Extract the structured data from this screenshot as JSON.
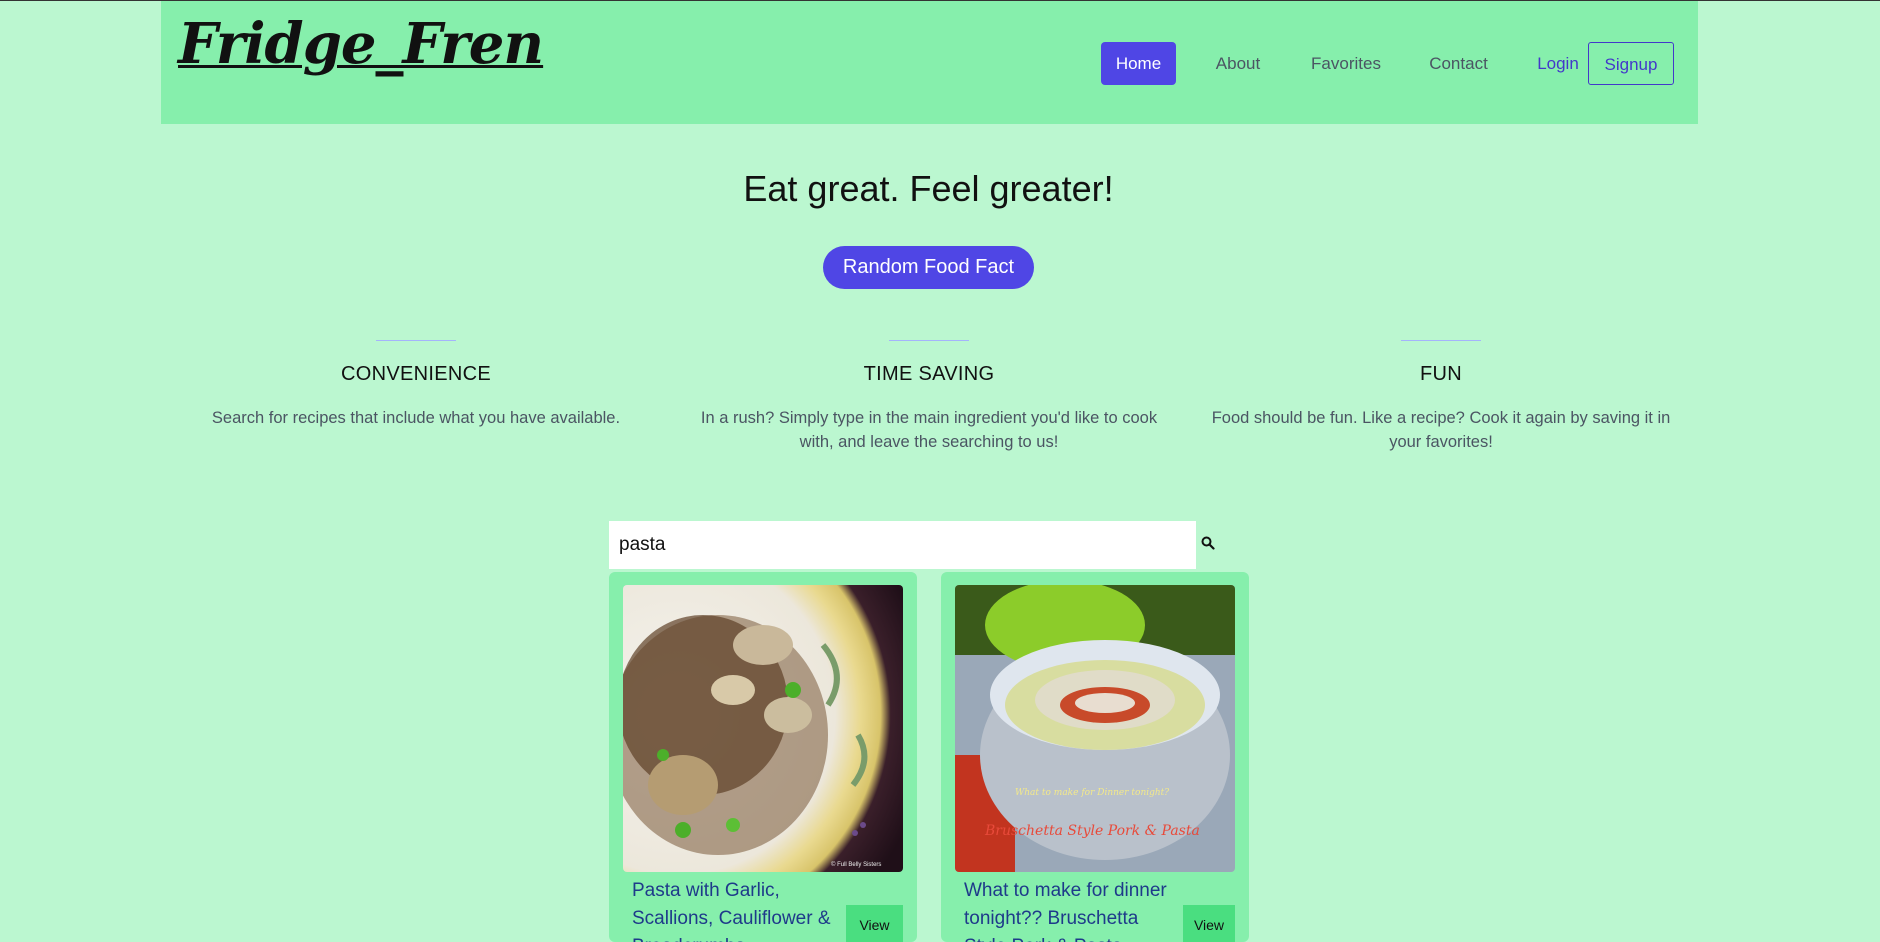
{
  "nav": {
    "logo": "Fridge_Fren",
    "home": "Home",
    "about": "About",
    "favorites": "Favorites",
    "contact": "Contact",
    "login": "Login",
    "signup": "Signup"
  },
  "hero": {
    "title": "Eat great. Feel greater!",
    "fact_button": "Random Food Fact"
  },
  "features": [
    {
      "title": "CONVENIENCE",
      "text": "Search for recipes that include what you have available."
    },
    {
      "title": "TIME SAVING",
      "text": "In a rush? Simply type in the main ingredient you'd like to cook with, and leave the searching to us!"
    },
    {
      "title": "FUN",
      "text": "Food should be fun. Like a recipe? Cook it again by saving it in your favorites!"
    }
  ],
  "search": {
    "value": "pasta",
    "icon": "search-icon"
  },
  "results": [
    {
      "title": "Pasta with Garlic, Scallions, Cauliflower & Breadcrumbs",
      "view": "View",
      "watermark": "© Full Belly Sisters"
    },
    {
      "title": "What to make for dinner tonight?? Bruschetta Style Pork & Pasta",
      "view": "View",
      "overlay_small": "What to make for Dinner tonight?",
      "overlay_large": "Bruschetta Style Pork & Pasta"
    }
  ],
  "colors": {
    "background": "#bbf7d0",
    "navbar": "#86efac",
    "accent": "#4f46e5",
    "link": "#4338ca",
    "view_button": "#4ade80"
  }
}
